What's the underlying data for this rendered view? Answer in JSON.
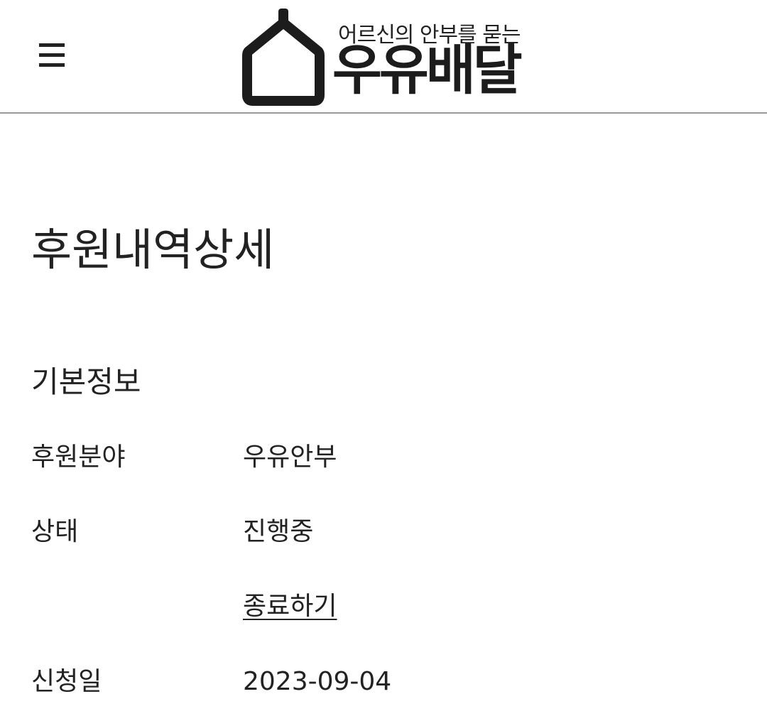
{
  "header": {
    "menu_icon": "hamburger-menu-icon",
    "logo": {
      "icon": "house-outline-icon",
      "tagline": "어르신의 안부를 묻는",
      "name": "우유배달"
    }
  },
  "main": {
    "title": "후원내역상세",
    "section_title": "기본정보",
    "rows": [
      {
        "label": "후원분야",
        "value": "우유안부"
      },
      {
        "label": "상태",
        "value": "진행중",
        "action_label": "종료하기"
      },
      {
        "label": "신청일",
        "value": "2023-09-04"
      }
    ]
  },
  "colors": {
    "text": "#222222",
    "divider": "#9a9a9a",
    "background": "#ffffff"
  }
}
